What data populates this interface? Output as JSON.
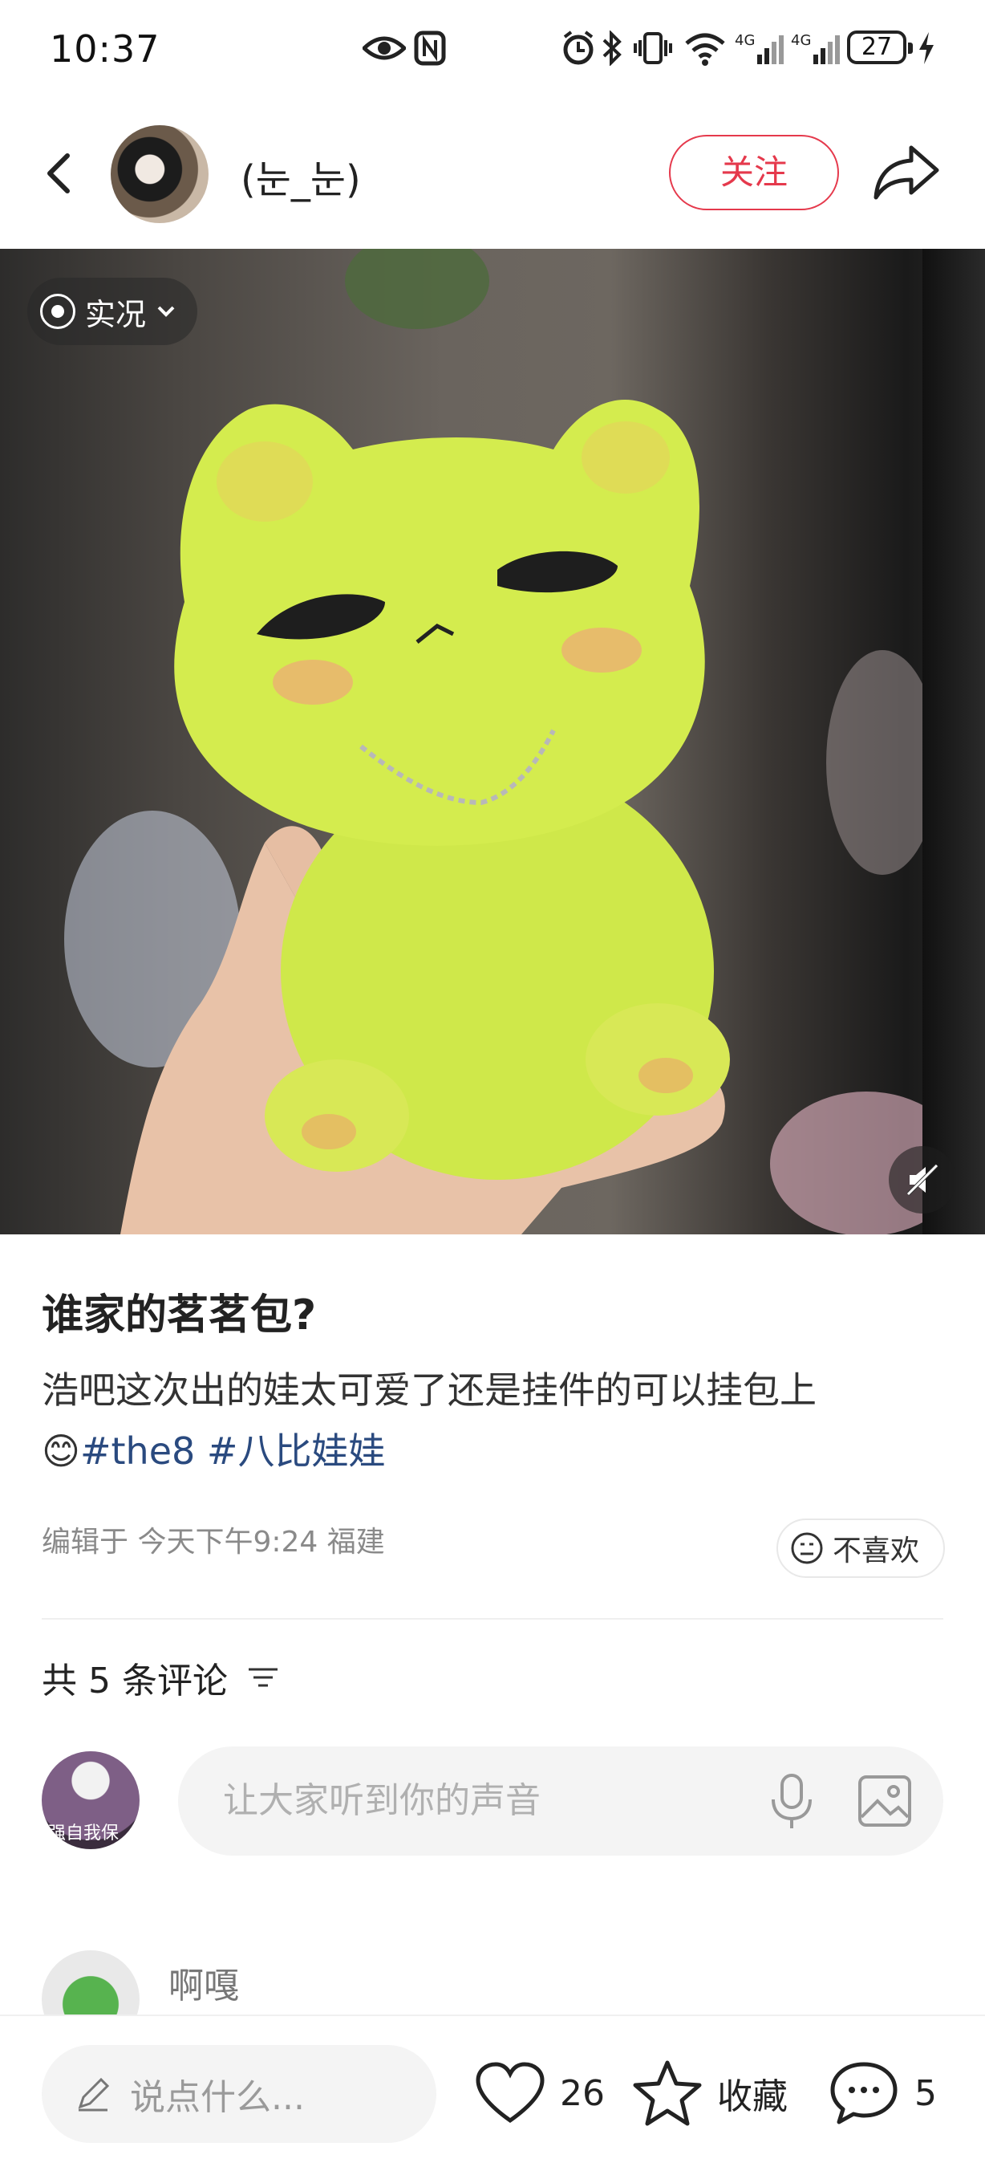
{
  "status_bar": {
    "time": "10:37",
    "battery": "27",
    "icons": [
      "eye-icon",
      "nfc-icon",
      "alarm-icon",
      "bluetooth-icon",
      "vibrate-icon",
      "wifi-icon",
      "signal-4g-icon",
      "signal-4g-icon",
      "charging-icon"
    ]
  },
  "header": {
    "username": "(눈_눈)",
    "follow_label": "关注",
    "accent": "#e5394c"
  },
  "media": {
    "live_label": "实况"
  },
  "post": {
    "title": "谁家的茗茗包?",
    "body_text": "浩吧这次出的娃太可爱了还是挂件的可以挂包上",
    "emoji": "😊",
    "hashtags": [
      "#the8",
      "#八比娃娃"
    ],
    "meta": "编辑于 今天下午9:24 福建",
    "dislike_label": "不喜欢"
  },
  "comments": {
    "count_label": "共 5 条评论",
    "input_placeholder": "让大家听到你的声音",
    "my_avatar_text": "强自我保",
    "first_comment_user": "啊嘎"
  },
  "bottom_bar": {
    "say_placeholder": "说点什么...",
    "likes": "26",
    "favorite_label": "收藏",
    "comments": "5"
  }
}
